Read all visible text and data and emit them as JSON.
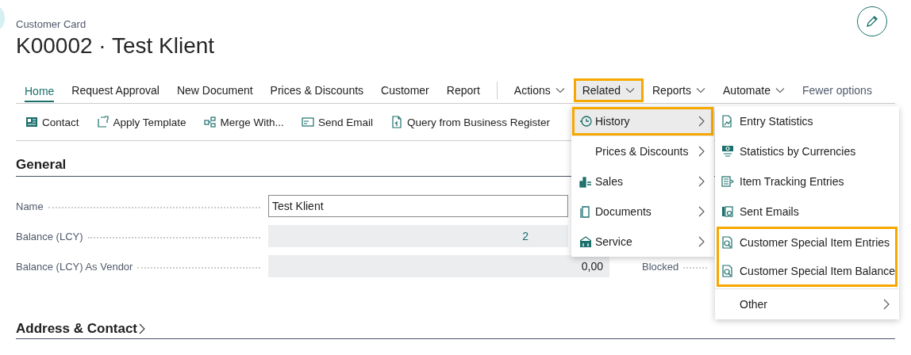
{
  "page": {
    "breadcrumb": "Customer Card",
    "title": "K00002 · Test Klient"
  },
  "action_tabs": [
    {
      "label": "Home",
      "selected": true,
      "dropdown": false,
      "highlighted": false,
      "open": false
    },
    {
      "label": "Request Approval",
      "selected": false,
      "dropdown": false,
      "highlighted": false,
      "open": false
    },
    {
      "label": "New Document",
      "selected": false,
      "dropdown": false,
      "highlighted": false,
      "open": false
    },
    {
      "label": "Prices & Discounts",
      "selected": false,
      "dropdown": false,
      "highlighted": false,
      "open": false
    },
    {
      "label": "Customer",
      "selected": false,
      "dropdown": false,
      "highlighted": false,
      "open": false
    },
    {
      "label": "Report",
      "selected": false,
      "dropdown": false,
      "highlighted": false,
      "open": false
    },
    {
      "label": "Actions",
      "selected": false,
      "dropdown": true,
      "highlighted": false,
      "open": false
    },
    {
      "label": "Related",
      "selected": false,
      "dropdown": true,
      "highlighted": true,
      "open": true
    },
    {
      "label": "Reports",
      "selected": false,
      "dropdown": true,
      "highlighted": false,
      "open": false
    },
    {
      "label": "Automate",
      "selected": false,
      "dropdown": true,
      "highlighted": false,
      "open": false
    }
  ],
  "fewer_options": "Fewer options",
  "toolbar": [
    "Contact",
    "Apply Template",
    "Merge With...",
    "Send Email",
    "Query from Business Register"
  ],
  "sections": [
    {
      "title": "General",
      "expandable": false
    },
    {
      "title": "Address & Contact",
      "expandable": true
    }
  ],
  "fields": [
    {
      "label": "Name",
      "value": "Test Klient",
      "editable": true,
      "link": false
    },
    {
      "label": "Balance (LCY)",
      "value": "2",
      "editable": false,
      "link": true
    },
    {
      "label": "Balance (LCY) As Vendor",
      "value": "0,00",
      "editable": false,
      "link": false
    }
  ],
  "right_fields": [
    {
      "label": "Blocked"
    }
  ],
  "related_menu": [
    {
      "label": "History",
      "selected": true,
      "highlighted": true,
      "icon": true
    },
    {
      "label": "Prices & Discounts",
      "selected": false,
      "highlighted": false,
      "icon": false
    },
    {
      "label": "Sales",
      "selected": false,
      "highlighted": false,
      "icon": true
    },
    {
      "label": "Documents",
      "selected": false,
      "highlighted": false,
      "icon": true
    },
    {
      "label": "Service",
      "selected": false,
      "highlighted": false,
      "icon": true
    }
  ],
  "history_submenu": [
    {
      "highlighted": false,
      "items": [
        {
          "label": "Entry Statistics",
          "submenu": false
        },
        {
          "label": "Statistics by Currencies",
          "submenu": false
        },
        {
          "label": "Item Tracking Entries",
          "submenu": false
        },
        {
          "label": "Sent Emails",
          "submenu": false
        }
      ]
    },
    {
      "highlighted": true,
      "items": [
        {
          "label": "Customer Special Item Entries",
          "submenu": false
        },
        {
          "label": "Customer Special Item Balance",
          "submenu": false
        }
      ]
    },
    {
      "highlighted": false,
      "items": [
        {
          "label": "Other",
          "submenu": true
        }
      ]
    }
  ]
}
